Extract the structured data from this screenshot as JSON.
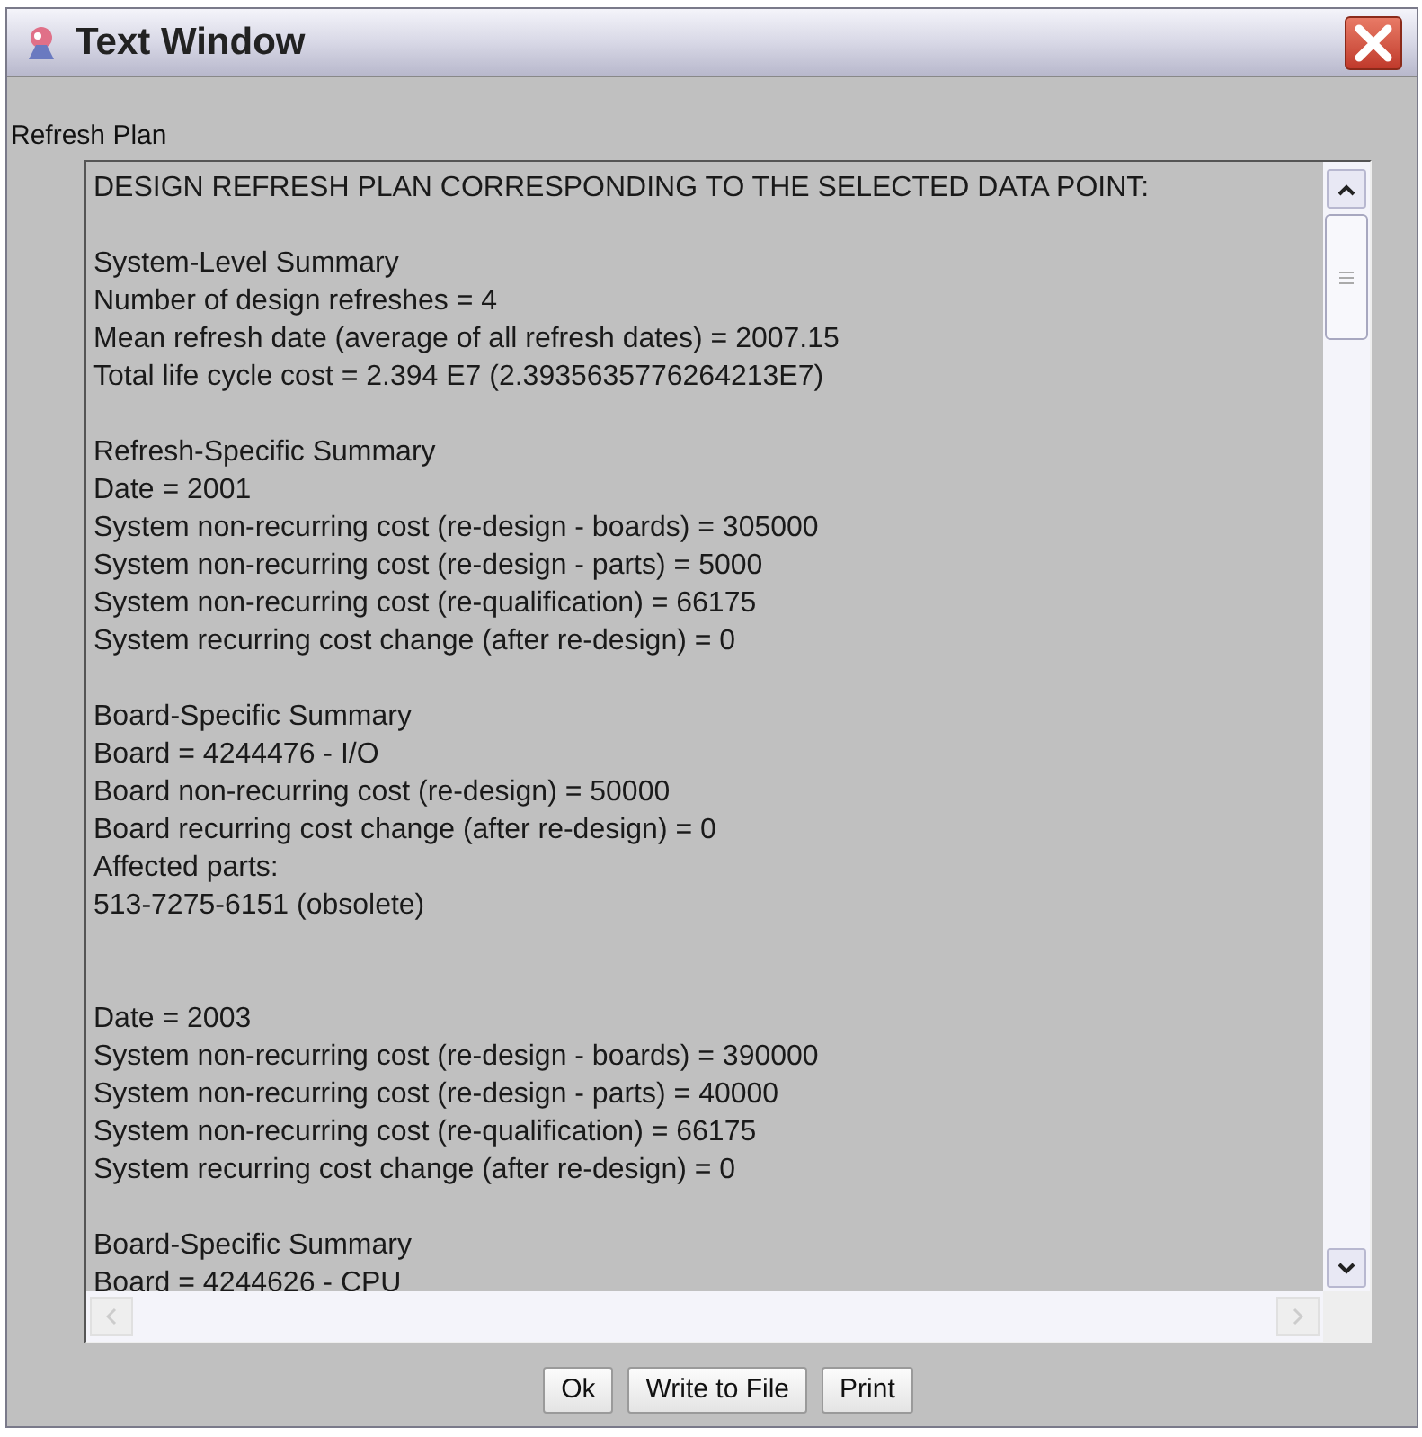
{
  "window": {
    "title": "Text Window"
  },
  "panel_label": "Refresh Plan",
  "text_area": {
    "groups": [
      {
        "paragraphs": [
          [
            "DESIGN REFRESH PLAN CORRESPONDING TO THE SELECTED DATA POINT:"
          ],
          [
            "System-Level Summary",
            "Number of design refreshes = 4",
            "Mean refresh date (average of all refresh dates) = 2007.15",
            "Total life cycle cost = 2.394 E7 (2.3935635776264213E7)"
          ],
          [
            "Refresh-Specific Summary",
            "Date = 2001",
            "System non-recurring cost (re-design - boards) = 305000",
            "System non-recurring cost (re-design - parts) = 5000",
            "System non-recurring cost (re-qualification) = 66175",
            "System recurring cost change (after re-design) = 0"
          ],
          [
            "Board-Specific Summary",
            "Board = 4244476 - I/O",
            "Board non-recurring cost (re-design) = 50000",
            "Board recurring cost change (after re-design) = 0",
            "Affected parts:",
            "513-7275-6151 (obsolete)"
          ]
        ]
      },
      {
        "paragraphs": [
          [
            "Date = 2003",
            "System non-recurring cost (re-design - boards) = 390000",
            "System non-recurring cost (re-design - parts) = 40000",
            "System non-recurring cost (re-qualification) = 66175",
            "System recurring cost change (after re-design) = 0"
          ],
          [
            "Board-Specific Summary",
            "Board = 4244626 - CPU"
          ]
        ]
      }
    ]
  },
  "buttons": [
    "Ok",
    "Write to File",
    "Print"
  ]
}
